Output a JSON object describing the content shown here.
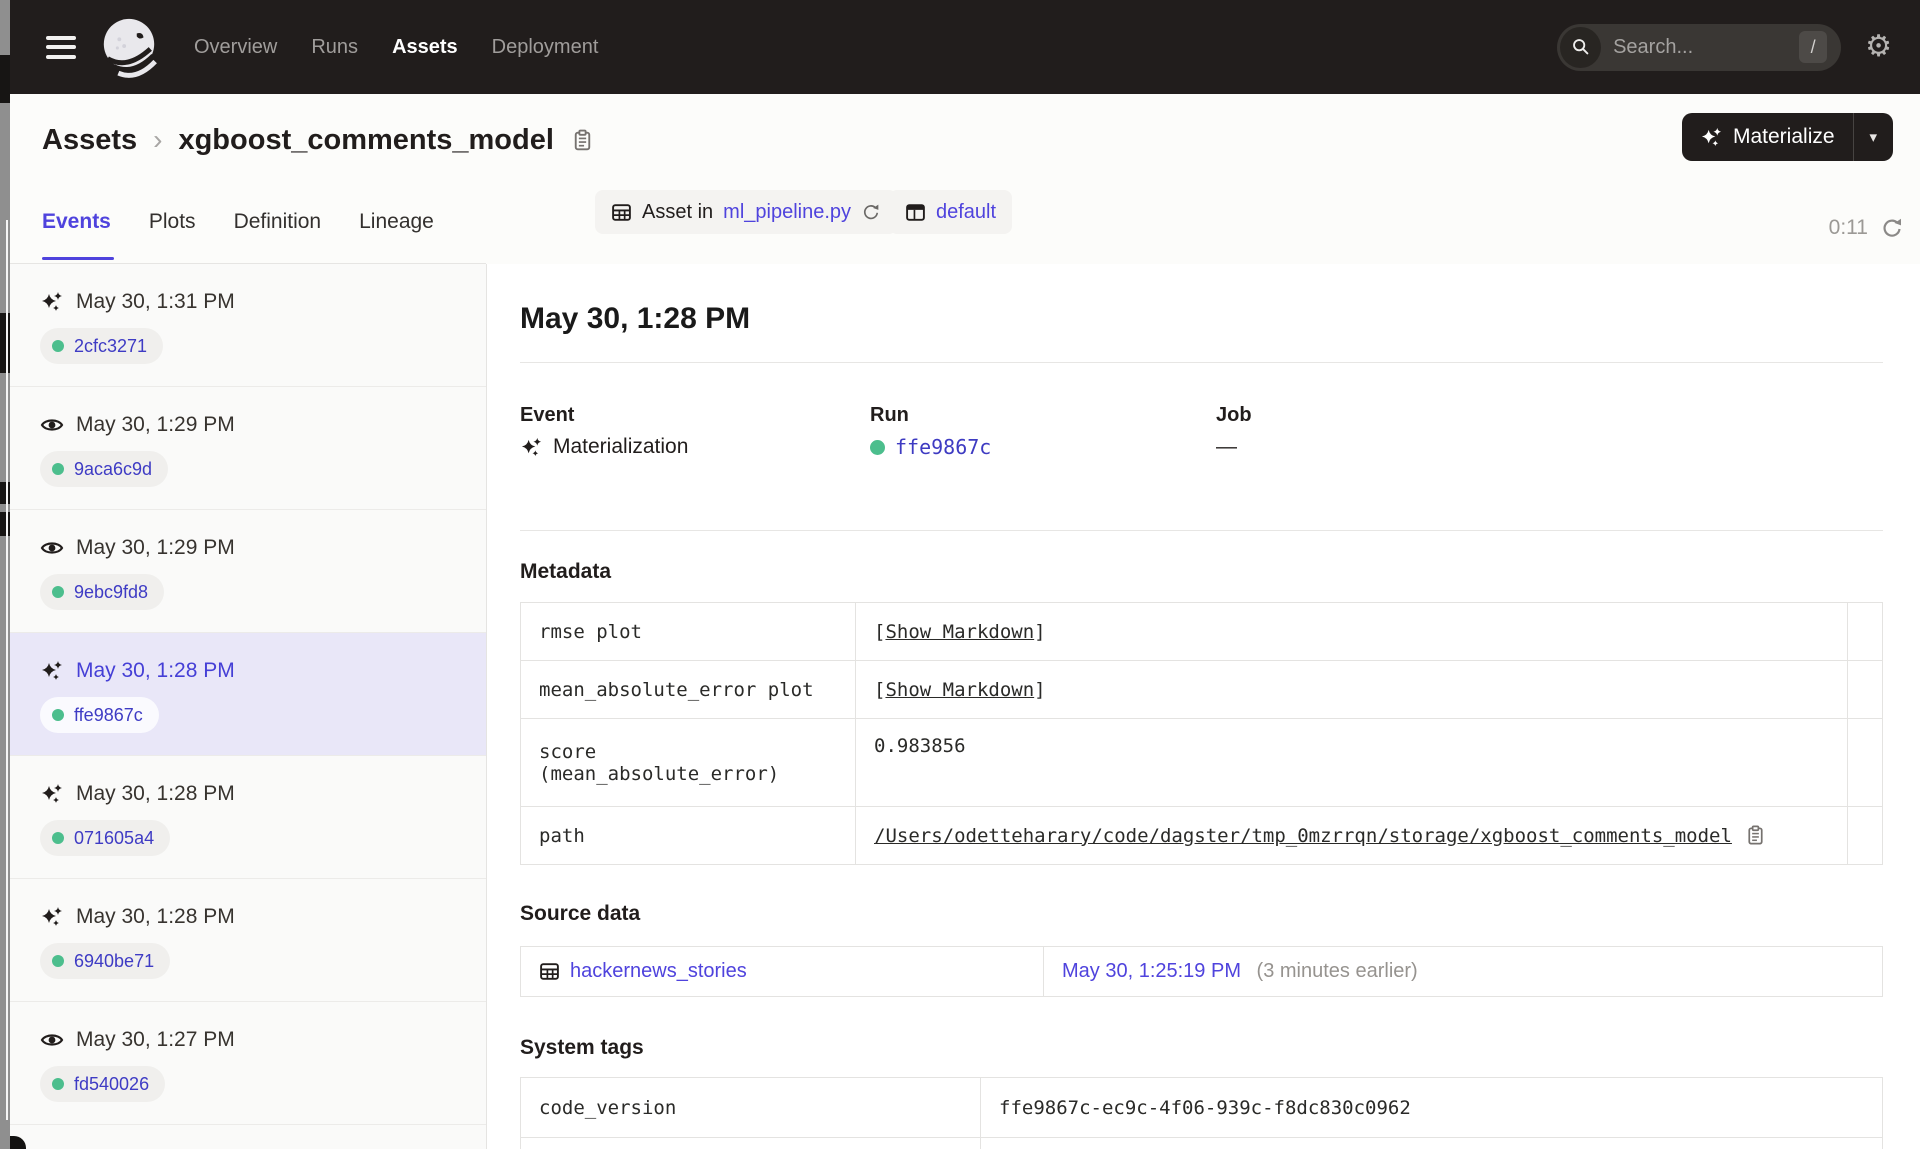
{
  "colors": {
    "accent": "#4F43DD",
    "success_green": "#4CBE8D",
    "nav_bg": "#211D1C"
  },
  "nav": {
    "items": [
      "Overview",
      "Runs",
      "Assets",
      "Deployment"
    ],
    "active": "Assets",
    "search": {
      "placeholder": "Search...",
      "shortcut": "/"
    }
  },
  "header": {
    "breadcrumb": {
      "root": "Assets",
      "separator": "›",
      "current": "xgboost_comments_model"
    },
    "asset_tag": {
      "prefix": "Asset in",
      "link": "ml_pipeline.py"
    },
    "repo_tag": {
      "label": "default"
    },
    "materialize": {
      "label": "Materialize"
    }
  },
  "tabs": {
    "items": [
      "Events",
      "Plots",
      "Definition",
      "Lineage"
    ],
    "active": "Events",
    "refresh_timer": "0:11"
  },
  "sidebar": {
    "events": [
      {
        "row_class": "ev mat-row",
        "icon": "materialization-icon",
        "time": "May 30, 1:31 PM",
        "run_id": "2cfc3271"
      },
      {
        "row_class": "ev obs-row",
        "icon": "observation-icon",
        "time": "May 30, 1:29 PM",
        "run_id": "9aca6c9d"
      },
      {
        "row_class": "ev obs-row",
        "icon": "observation-icon",
        "time": "May 30, 1:29 PM",
        "run_id": "9ebc9fd8"
      },
      {
        "row_class": "ev mat-row sel",
        "icon": "materialization-icon",
        "time": "May 30, 1:28 PM",
        "run_id": "ffe9867c"
      },
      {
        "row_class": "ev mat-row",
        "icon": "materialization-icon",
        "time": "May 30, 1:28 PM",
        "run_id": "071605a4"
      },
      {
        "row_class": "ev mat-row",
        "icon": "materialization-icon",
        "time": "May 30, 1:28 PM",
        "run_id": "6940be71"
      },
      {
        "row_class": "ev obs-row",
        "icon": "observation-icon",
        "time": "May 30, 1:27 PM",
        "run_id": "fd540026"
      }
    ]
  },
  "detail": {
    "title": "May 30, 1:28 PM",
    "event": {
      "label": "Event",
      "value": "Materialization"
    },
    "run": {
      "label": "Run",
      "value": "ffe9867c"
    },
    "job": {
      "label": "Job",
      "value": "—"
    },
    "metadata": {
      "heading": "Metadata",
      "rows": [
        {
          "label": "rmse plot",
          "prefix": "[",
          "link": "Show Markdown",
          "suffix": "]"
        },
        {
          "label": "mean_absolute_error plot",
          "prefix": "[",
          "link": "Show Markdown",
          "suffix": "]"
        },
        {
          "label_line1": "score",
          "label_line2": "(mean_absolute_error)",
          "value": "0.983856"
        },
        {
          "label": "path",
          "link": "/Users/odetteharary/code/dagster/tmp_0mzrrqn/storage/xgboost_comments_model"
        }
      ]
    },
    "source_data": {
      "heading": "Source data",
      "asset": "hackernews_stories",
      "timestamp": "May 30, 1:25:19 PM",
      "note": "(3 minutes earlier)"
    },
    "system_tags": {
      "heading": "System tags",
      "rows": [
        {
          "key": "code_version",
          "value": "ffe9867c-ec9c-4f06-939c-f8dc830c0962"
        }
      ]
    }
  }
}
